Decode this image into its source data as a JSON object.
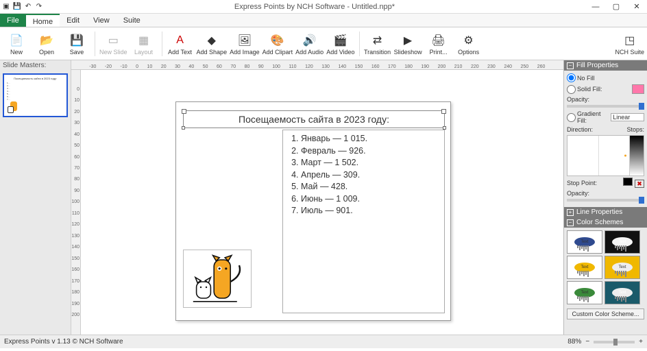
{
  "app": {
    "title": "Express Points by NCH Software - Untitled.npp*",
    "status": "Express Points v 1.13 © NCH Software",
    "zoom": "88%"
  },
  "menu": {
    "file": "File",
    "home": "Home",
    "edit": "Edit",
    "view": "View",
    "suite": "Suite"
  },
  "tools": {
    "new": "New",
    "open": "Open",
    "save": "Save",
    "newslide": "New Slide",
    "layout": "Layout",
    "addtext": "Add Text",
    "addshape": "Add Shape",
    "addimage": "Add Image",
    "addclipart": "Add Clipart",
    "addaudio": "Add Audio",
    "addvideo": "Add Video",
    "transition": "Transition",
    "slideshow": "Slideshow",
    "print": "Print...",
    "options": "Options",
    "nchsuite": "NCH Suite"
  },
  "sidepanel": {
    "header": "Slide Masters:"
  },
  "ruler_h": [
    "-30",
    "-20",
    "-10",
    "0",
    "10",
    "20",
    "30",
    "40",
    "50",
    "60",
    "70",
    "80",
    "90",
    "100",
    "110",
    "120",
    "130",
    "140",
    "150",
    "160",
    "170",
    "180",
    "190",
    "200",
    "210",
    "220",
    "230",
    "240",
    "250",
    "260"
  ],
  "ruler_v": [
    "0",
    "10",
    "20",
    "30",
    "40",
    "50",
    "60",
    "70",
    "80",
    "90",
    "100",
    "110",
    "120",
    "130",
    "140",
    "150",
    "160",
    "170",
    "180",
    "190",
    "200"
  ],
  "slide": {
    "title": "Посещаемость сайта в 2023 году:",
    "list": [
      "Январь — 1 015.",
      "Февраль — 926.",
      "Март — 1 502.",
      "Апрель — 309.",
      "Май — 428.",
      "Июнь — 1 009.",
      "Июль — 901."
    ]
  },
  "fill": {
    "header": "Fill Properties",
    "nofill": "No Fill",
    "solidfill": "Solid Fill:",
    "opacity": "Opacity:",
    "gradfill": "Gradient Fill:",
    "gradtype": "Linear",
    "direction": "Direction:",
    "stops": "Stops:",
    "stoppoint": "Stop Point:"
  },
  "line": {
    "header": "Line Properties"
  },
  "colors": {
    "header": "Color Schemes",
    "custom": "Custom Color Scheme...",
    "schemes": [
      {
        "blob": "#2f4a8f",
        "bg": "#fff"
      },
      {
        "blob": "#f5f5f5",
        "bg": "#111"
      },
      {
        "blob": "#f0b800",
        "bg": "#fff"
      },
      {
        "blob": "#eee",
        "bg": "#f0b800"
      },
      {
        "blob": "#3a8a3a",
        "bg": "#fff"
      },
      {
        "blob": "#eee",
        "bg": "#1a5a6a"
      }
    ]
  }
}
